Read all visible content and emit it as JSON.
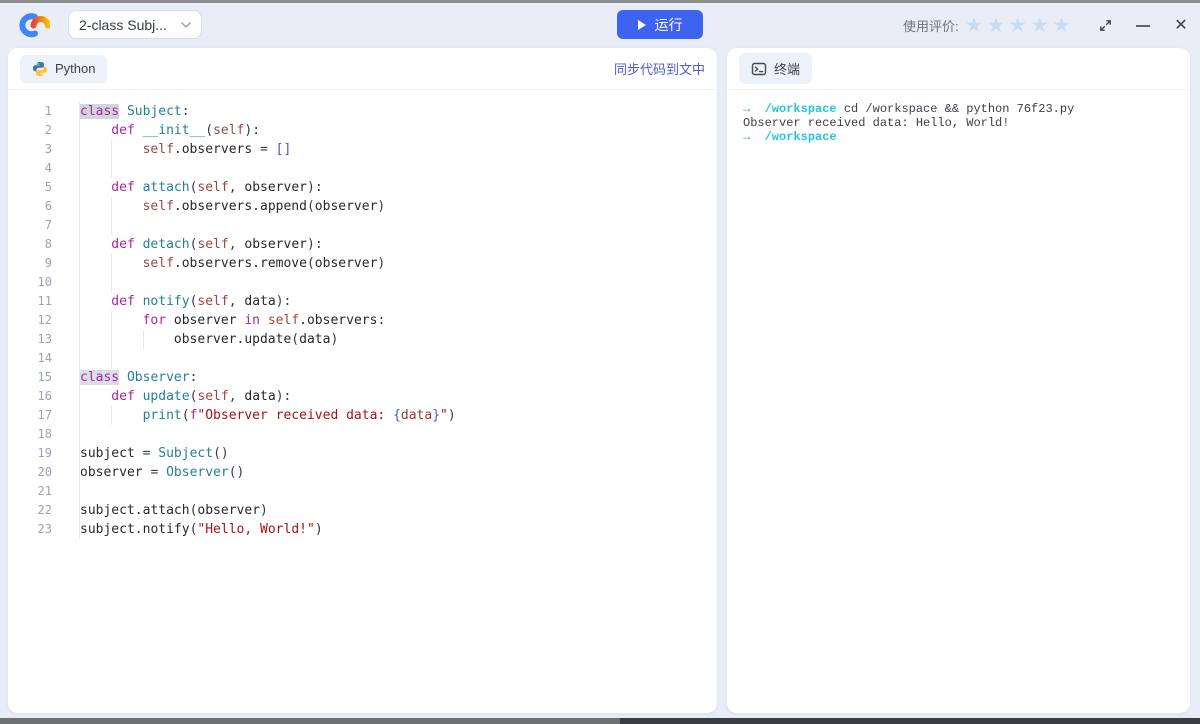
{
  "header": {
    "doc_selector": {
      "label": "2-class Subj..."
    },
    "run_button": {
      "label": "运行"
    },
    "rating": {
      "label": "使用评价:",
      "star_count": 5,
      "stars_filled": 0
    }
  },
  "left_panel": {
    "tab_label": "Python",
    "sync_link": "同步代码到文中"
  },
  "right_panel": {
    "tab_label": "终端"
  },
  "editor": {
    "lines": [
      {
        "n": "1",
        "t": [
          [
            "caret",
            ""
          ],
          [
            "kw sel",
            "class"
          ],
          [
            "pln",
            " "
          ],
          [
            "cls",
            "Subject"
          ],
          [
            "op",
            ":"
          ]
        ]
      },
      {
        "n": "2",
        "t": [
          [
            "sp",
            "    "
          ],
          [
            "kw",
            "def"
          ],
          [
            "pln",
            " "
          ],
          [
            "fn",
            "__init__"
          ],
          [
            "op",
            "("
          ],
          [
            "self",
            "self"
          ],
          [
            "op",
            "):"
          ]
        ]
      },
      {
        "n": "3",
        "t": [
          [
            "sp",
            "    "
          ],
          [
            "ind",
            "    "
          ],
          [
            "self",
            "self"
          ],
          [
            "pln",
            ".observers"
          ],
          [
            "op",
            " = "
          ],
          [
            "brk",
            "[]"
          ]
        ]
      },
      {
        "n": "4",
        "t": [
          [
            "sp",
            "    "
          ],
          [
            "ind",
            "    "
          ]
        ]
      },
      {
        "n": "5",
        "t": [
          [
            "sp",
            "    "
          ],
          [
            "kw",
            "def"
          ],
          [
            "pln",
            " "
          ],
          [
            "fn",
            "attach"
          ],
          [
            "op",
            "("
          ],
          [
            "self",
            "self"
          ],
          [
            "op",
            ", "
          ],
          [
            "pln",
            "observer"
          ],
          [
            "op",
            "):"
          ]
        ]
      },
      {
        "n": "6",
        "t": [
          [
            "sp",
            "    "
          ],
          [
            "ind",
            "    "
          ],
          [
            "self",
            "self"
          ],
          [
            "pln",
            ".observers.append"
          ],
          [
            "op",
            "("
          ],
          [
            "pln",
            "observer"
          ],
          [
            "op",
            ")"
          ]
        ]
      },
      {
        "n": "7",
        "t": [
          [
            "sp",
            "    "
          ],
          [
            "ind",
            "    "
          ]
        ]
      },
      {
        "n": "8",
        "t": [
          [
            "sp",
            "    "
          ],
          [
            "kw",
            "def"
          ],
          [
            "pln",
            " "
          ],
          [
            "fn",
            "detach"
          ],
          [
            "op",
            "("
          ],
          [
            "self",
            "self"
          ],
          [
            "op",
            ", "
          ],
          [
            "pln",
            "observer"
          ],
          [
            "op",
            "):"
          ]
        ]
      },
      {
        "n": "9",
        "t": [
          [
            "sp",
            "    "
          ],
          [
            "ind",
            "    "
          ],
          [
            "self",
            "self"
          ],
          [
            "pln",
            ".observers.remove"
          ],
          [
            "op",
            "("
          ],
          [
            "pln",
            "observer"
          ],
          [
            "op",
            ")"
          ]
        ]
      },
      {
        "n": "10",
        "t": [
          [
            "sp",
            "    "
          ],
          [
            "ind",
            "    "
          ]
        ]
      },
      {
        "n": "11",
        "t": [
          [
            "sp",
            "    "
          ],
          [
            "kw",
            "def"
          ],
          [
            "pln",
            " "
          ],
          [
            "fn",
            "notify"
          ],
          [
            "op",
            "("
          ],
          [
            "self",
            "self"
          ],
          [
            "op",
            ", "
          ],
          [
            "pln",
            "data"
          ],
          [
            "op",
            "):"
          ]
        ]
      },
      {
        "n": "12",
        "t": [
          [
            "sp",
            "    "
          ],
          [
            "ind",
            "    "
          ],
          [
            "kw",
            "for"
          ],
          [
            "pln",
            " observer "
          ],
          [
            "kw",
            "in"
          ],
          [
            "pln",
            " "
          ],
          [
            "self",
            "self"
          ],
          [
            "pln",
            ".observers"
          ],
          [
            "op",
            ":"
          ]
        ]
      },
      {
        "n": "13",
        "t": [
          [
            "sp",
            "    "
          ],
          [
            "ind",
            "    "
          ],
          [
            "ind",
            "    "
          ],
          [
            "pln",
            "observer.update"
          ],
          [
            "op",
            "("
          ],
          [
            "pln",
            "data"
          ],
          [
            "op",
            ")"
          ]
        ]
      },
      {
        "n": "14",
        "t": [
          [
            "sp",
            "    "
          ],
          [
            "ind",
            "    "
          ]
        ]
      },
      {
        "n": "15",
        "t": [
          [
            "kw occ",
            "class"
          ],
          [
            "pln",
            " "
          ],
          [
            "cls",
            "Observer"
          ],
          [
            "op",
            ":"
          ]
        ]
      },
      {
        "n": "16",
        "t": [
          [
            "sp",
            "    "
          ],
          [
            "kw",
            "def"
          ],
          [
            "pln",
            " "
          ],
          [
            "fn",
            "update"
          ],
          [
            "op",
            "("
          ],
          [
            "self",
            "self"
          ],
          [
            "op",
            ", "
          ],
          [
            "pln",
            "data"
          ],
          [
            "op",
            "):"
          ]
        ]
      },
      {
        "n": "17",
        "t": [
          [
            "sp",
            "    "
          ],
          [
            "ind",
            "    "
          ],
          [
            "fn",
            "print"
          ],
          [
            "op",
            "("
          ],
          [
            "kw",
            "f"
          ],
          [
            "str",
            "\"Observer received data: "
          ],
          [
            "brk",
            "{"
          ],
          [
            "fvar",
            "data"
          ],
          [
            "brk",
            "}"
          ],
          [
            "str",
            "\""
          ],
          [
            "op",
            ")"
          ]
        ]
      },
      {
        "n": "18",
        "t": []
      },
      {
        "n": "19",
        "t": [
          [
            "pln",
            "subject "
          ],
          [
            "op",
            "= "
          ],
          [
            "cls",
            "Subject"
          ],
          [
            "op",
            "()"
          ]
        ]
      },
      {
        "n": "20",
        "t": [
          [
            "pln",
            "observer "
          ],
          [
            "op",
            "= "
          ],
          [
            "cls",
            "Observer"
          ],
          [
            "op",
            "()"
          ]
        ]
      },
      {
        "n": "21",
        "t": []
      },
      {
        "n": "22",
        "t": [
          [
            "pln",
            "subject.attach"
          ],
          [
            "op",
            "("
          ],
          [
            "pln",
            "observer"
          ],
          [
            "op",
            ")"
          ]
        ]
      },
      {
        "n": "23",
        "t": [
          [
            "pln",
            "subject.notify"
          ],
          [
            "op",
            "("
          ],
          [
            "str",
            "\"Hello, World!\""
          ],
          [
            "op",
            ")"
          ]
        ]
      }
    ]
  },
  "terminal": {
    "lines": [
      {
        "t": [
          [
            "arrow",
            "→"
          ],
          [
            "path",
            "  /workspace "
          ],
          [
            "cmd",
            "cd /workspace && python 76f23.py"
          ]
        ]
      },
      {
        "t": [
          [
            "cmd",
            "Observer received data: Hello, World!"
          ]
        ]
      },
      {
        "t": [
          [
            "arrow",
            "→"
          ],
          [
            "path",
            "  /workspace"
          ]
        ]
      }
    ]
  },
  "colors": {
    "run_button": "#3D63F0",
    "sync_link": "#515BD4",
    "terminal_prompt_arrow": "#23B14D",
    "terminal_path": "#26C6DA",
    "syntax_keyword": "#A626A4",
    "syntax_class_fn": "#267F99",
    "syntax_self": "#A0453F",
    "syntax_string": "#A31515",
    "syntax_bracket": "#4452D6",
    "star": "#CBDCF1",
    "page_bg": "#E9EDF8"
  }
}
